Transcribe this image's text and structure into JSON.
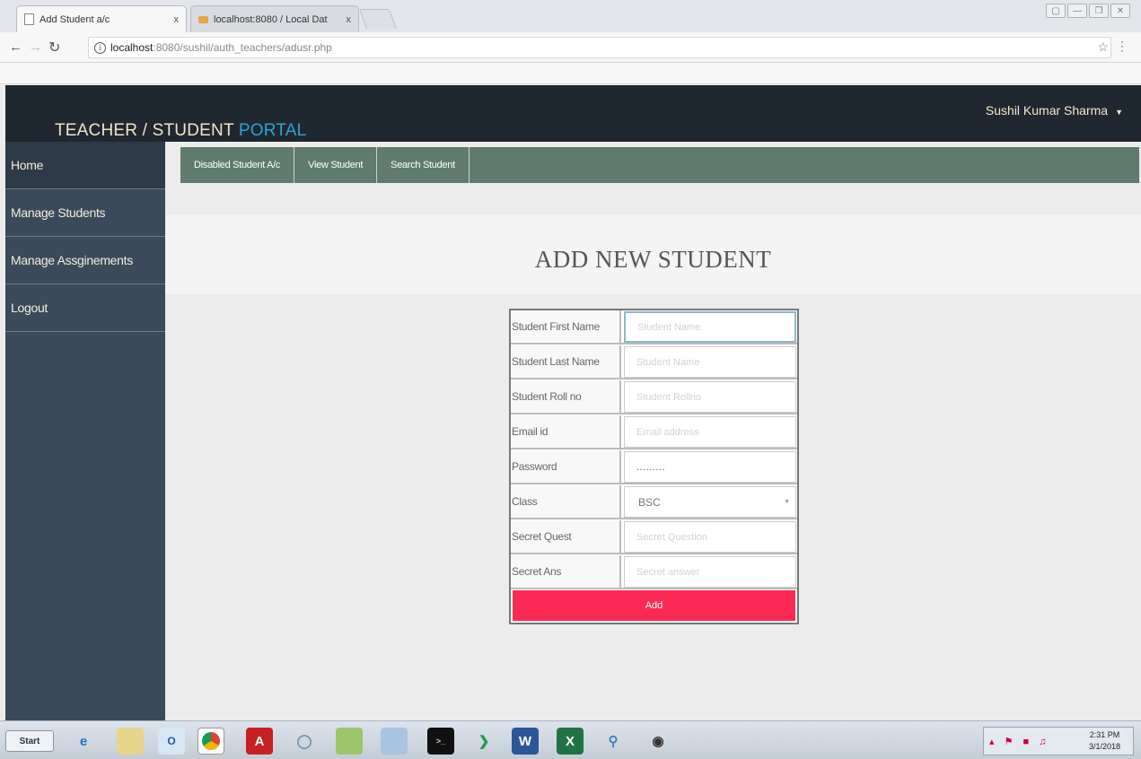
{
  "browser": {
    "tabs": [
      {
        "title": "Add Student a/c",
        "close": "x"
      },
      {
        "title": "localhost:8080 / Local Dat",
        "close": "x"
      }
    ],
    "url_host": "localhost",
    "url_path": ":8080/sushil/auth_teachers/adusr.php"
  },
  "header": {
    "brand_main": "TEACHER / STUDENT",
    "brand_accent": "PORTAL",
    "user_name": "Sushil Kumar Sharma"
  },
  "sidebar": {
    "items": [
      {
        "label": "Home"
      },
      {
        "label": "Manage Students"
      },
      {
        "label": "Manage Assginements"
      },
      {
        "label": "Logout"
      }
    ]
  },
  "subnav": {
    "items": [
      {
        "label": "Disabled Student A/c"
      },
      {
        "label": "View Student"
      },
      {
        "label": "Search Student"
      }
    ]
  },
  "main": {
    "title": "ADD NEW STUDENT"
  },
  "form": {
    "first_name": {
      "label": "Student First Name",
      "placeholder": "Student Name"
    },
    "last_name": {
      "label": "Student Last Name",
      "placeholder": "Student Name"
    },
    "roll_no": {
      "label": "Student Roll no",
      "placeholder": "Student Rollno"
    },
    "email": {
      "label": "Email id",
      "placeholder": "Email address"
    },
    "password": {
      "label": "Password",
      "value": "........."
    },
    "class": {
      "label": "Class",
      "selected": "BSC"
    },
    "secret_quest": {
      "label": "Secret Quest",
      "placeholder": "Secret Question"
    },
    "secret_ans": {
      "label": "Secret Ans",
      "placeholder": "Secret answer"
    },
    "submit_label": "Add"
  },
  "taskbar": {
    "start_label": "Start",
    "clock_time": "2:31 PM",
    "clock_date": "3/1/2018",
    "icons": [
      "ie-icon",
      "folder-icon",
      "outlook-icon",
      "chrome-icon",
      "acrobat-icon",
      "cd-icon",
      "app-icon",
      "notepad-icon",
      "terminal-icon",
      "vscode-icon",
      "word-icon",
      "excel-icon",
      "search-icon",
      "media-icon"
    ]
  },
  "colors": {
    "header_bg": "#1f2731",
    "brand_accent": "#2ea3d8",
    "sidebar_bg": "#3a4a5c",
    "subnav_bg": "#5f7c6e",
    "add_button": "#fb2a55"
  }
}
